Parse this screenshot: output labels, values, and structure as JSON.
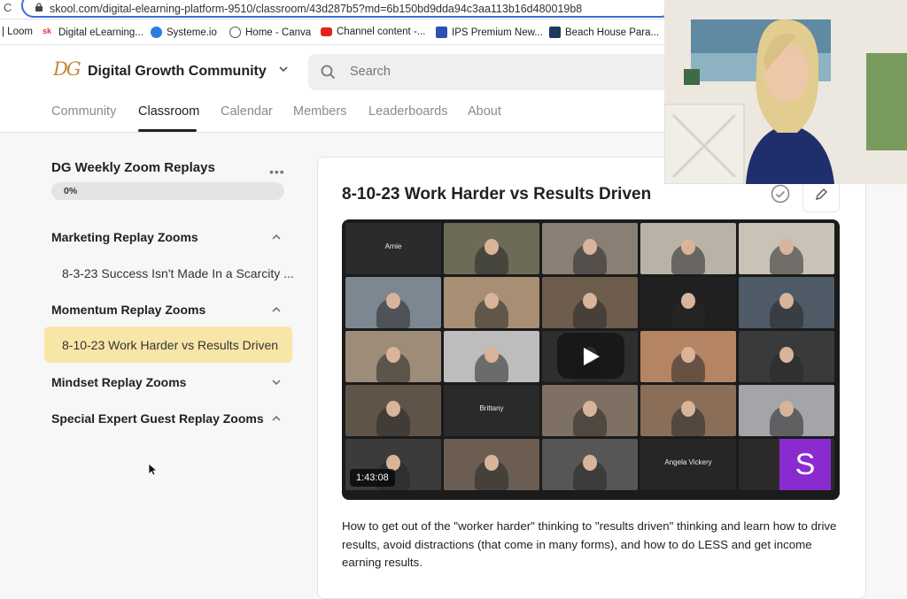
{
  "browser": {
    "url": "skool.com/digital-elearning-platform-9510/classroom/43d287b5?md=6b150bd9dda94c3aa113b16d480019b8",
    "bookmarks": [
      {
        "label": "| Loom",
        "icon": "loom-icon"
      },
      {
        "label": "Digital eLearning...",
        "icon": "skool-favicon-icon"
      },
      {
        "label": "Systeme.io",
        "icon": "systeme-icon"
      },
      {
        "label": "Home - Canva",
        "icon": "canva-icon"
      },
      {
        "label": "Channel content -...",
        "icon": "youtube-icon"
      },
      {
        "label": "IPS Premium New...",
        "icon": "ips-icon"
      },
      {
        "label": "Beach House Para...",
        "icon": "beach-house-icon"
      }
    ]
  },
  "header": {
    "logo": "DG",
    "community_name": "Digital Growth Community",
    "search_placeholder": "Search",
    "tabs": [
      "Community",
      "Classroom",
      "Calendar",
      "Members",
      "Leaderboards",
      "About"
    ],
    "active_tab": "Classroom"
  },
  "sidebar": {
    "course_title": "DG Weekly Zoom Replays",
    "menu_glyph": "•••",
    "progress_label": "0%",
    "progress": 0,
    "sections": [
      {
        "title": "Marketing Replay Zooms",
        "expanded": true,
        "lessons": [
          "8-3-23 Success Isn't Made In a Scarcity ..."
        ]
      },
      {
        "title": "Momentum Replay Zooms",
        "expanded": true,
        "lessons": [
          "8-10-23 Work Harder vs Results Driven"
        ]
      },
      {
        "title": "Mindset Replay Zooms",
        "expanded": false,
        "lessons": []
      },
      {
        "title": "Special Expert Guest Replay Zooms",
        "expanded": true,
        "lessons": []
      }
    ]
  },
  "lesson": {
    "title": "8-10-23 Work Harder vs Results Driven",
    "duration": "1:43:08",
    "description": "How to get out of the \"worker harder\" thinking to \"results driven\" thinking and learn how to drive results, avoid distractions (that come in many forms), and how to do LESS and get income earning results.",
    "video_tiles": [
      {
        "name": "Arnie",
        "bg": "#2b2b2b",
        "center": "Arnie"
      },
      {
        "name": "",
        "bg": "#6d6a57"
      },
      {
        "name": "",
        "bg": "#8a7f74"
      },
      {
        "name": "",
        "bg": "#b9b2a6"
      },
      {
        "name": "",
        "bg": "#c9c2b6"
      },
      {
        "name": "",
        "bg": "#7d8791"
      },
      {
        "name": "",
        "bg": "#a88f74"
      },
      {
        "name": "",
        "bg": "#6e5d4c"
      },
      {
        "name": "",
        "bg": "#202020"
      },
      {
        "name": "",
        "bg": "#4e5a66"
      },
      {
        "name": "",
        "bg": "#9c8c78"
      },
      {
        "name": "",
        "bg": "#bdbdbd"
      },
      {
        "name": "",
        "bg": "#2e2e2e"
      },
      {
        "name": "",
        "bg": "#b58463"
      },
      {
        "name": "",
        "bg": "#3a3a3a"
      },
      {
        "name": "",
        "bg": "#605449"
      },
      {
        "name": "Brittany",
        "bg": "#2a2a2a",
        "center": "Brittany"
      },
      {
        "name": "",
        "bg": "#7e7163"
      },
      {
        "name": "",
        "bg": "#8a6e58"
      },
      {
        "name": "",
        "bg": "#a3a5a8"
      },
      {
        "name": "",
        "bg": "#3b3b3b"
      },
      {
        "name": "",
        "bg": "#6b5d52"
      },
      {
        "name": "",
        "bg": "#565656"
      },
      {
        "name": "Angela Vickery",
        "bg": "#262626",
        "center": "Angela Vickery"
      },
      {
        "name": "",
        "bg": "#2a2a2a",
        "avatar": "S"
      }
    ]
  },
  "colors": {
    "active_lesson_bg": "#f8e6a8",
    "url_border": "#3b6fd8",
    "avatar_purple": "#8a2bd0"
  }
}
